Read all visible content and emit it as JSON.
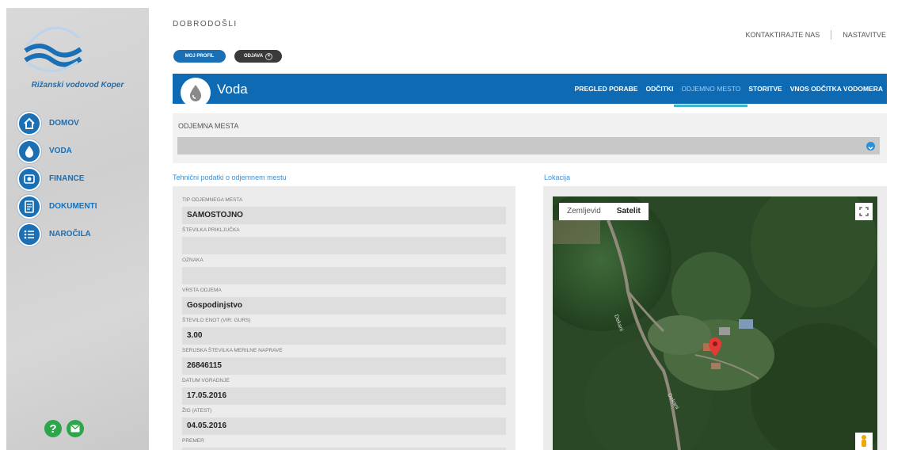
{
  "sidebar": {
    "brand": "Rižanski vodovod Koper",
    "items": [
      {
        "label": "DOMOV",
        "icon": "home-icon"
      },
      {
        "label": "VODA",
        "icon": "water-drop-icon"
      },
      {
        "label": "FINANCE",
        "icon": "coins-icon"
      },
      {
        "label": "DOKUMENTI",
        "icon": "document-icon"
      },
      {
        "label": "NAROČILA",
        "icon": "order-list-icon"
      }
    ],
    "help_glyph": "?"
  },
  "header": {
    "welcome": "DOBRODOŠLI",
    "contact": "KONTAKTIRAJTE NAS",
    "settings": "NASTAVITVE",
    "profile_button": "MOJ PROFIL",
    "logout_button": "ODJAVA"
  },
  "bar": {
    "title": "Voda",
    "tabs": [
      {
        "label": "PREGLED PORABE",
        "active": false
      },
      {
        "label": "ODČITKI",
        "active": false
      },
      {
        "label": "ODJEMNO MESTO",
        "active": true
      },
      {
        "label": "STORITVE",
        "active": false
      },
      {
        "label": "VNOS ODČITKA VODOMERA",
        "active": false
      }
    ]
  },
  "odjemna_mesta": {
    "label": "ODJEMNA MESTA",
    "selected": ""
  },
  "tech": {
    "title": "Tehnični podatki o odjemnem mestu",
    "fields": [
      {
        "label": "TIP ODJEMNEGA MESTA",
        "value": "SAMOSTOJNO"
      },
      {
        "label": "ŠTEVILKA PRIKLJUČKA",
        "value": ""
      },
      {
        "label": "OZNAKA",
        "value": ""
      },
      {
        "label": "VRSTA ODJEMA",
        "value": "Gospodinjstvo"
      },
      {
        "label": "ŠTEVILO ENOT (VIR: GURS)",
        "value": "3.00"
      },
      {
        "label": "SERIJSKA ŠTEVILKA MERILNE NAPRAVE",
        "value": "26846115"
      },
      {
        "label": "DATUM VGRADNJE",
        "value": "17.05.2016"
      },
      {
        "label": "ŽIG (ATEST)",
        "value": "04.05.2016"
      },
      {
        "label": "PREMER",
        "value": ""
      }
    ]
  },
  "location": {
    "title": "Lokacija",
    "map_type_buttons": [
      {
        "label": "Zemljevid",
        "selected": false
      },
      {
        "label": "Satelit",
        "selected": true
      }
    ],
    "road_label_1": "Dekani",
    "road_label_2": "Dekani"
  },
  "colors": {
    "primary": "#0d6ab3",
    "accent": "#3bb6c7",
    "help_green": "#2ba64a"
  }
}
